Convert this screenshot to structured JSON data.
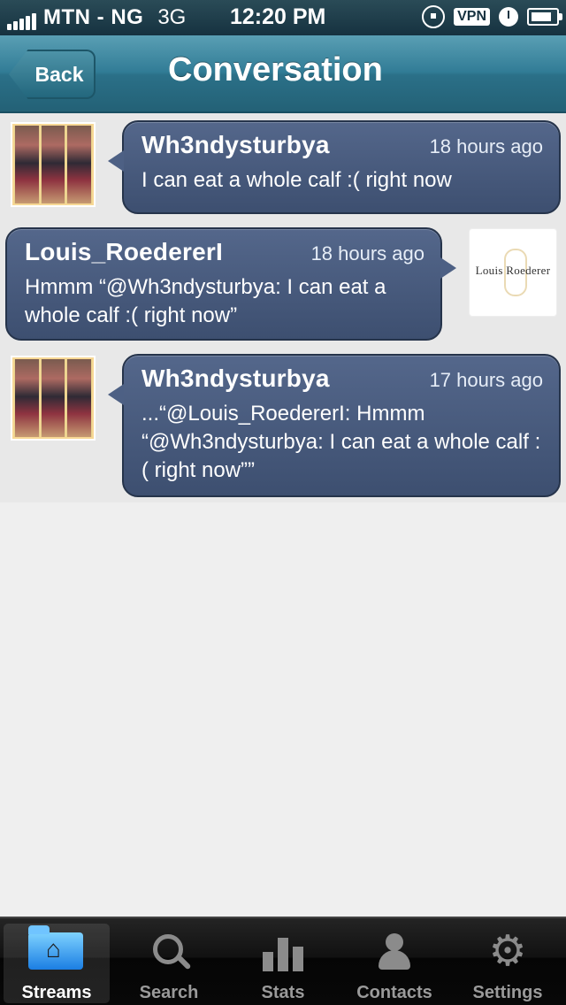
{
  "status_bar": {
    "carrier": "MTN - NG",
    "network": "3G",
    "time": "12:20 PM",
    "vpn": "VPN"
  },
  "header": {
    "back_label": "Back",
    "title": "Conversation"
  },
  "messages": [
    {
      "author": "Wh3ndysturbya",
      "time": "18 hours ago",
      "text": "I can eat a whole calf :( right now"
    },
    {
      "author": "Louis_RoedererI",
      "time": "18 hours ago",
      "text": "Hmmm “@Wh3ndysturbya: I can eat a whole calf :( right now”",
      "logo_text": "Louis Roederer"
    },
    {
      "author": "Wh3ndysturbya",
      "time": "17 hours ago",
      "text": "...“@Louis_RoedererI: Hmmm “@Wh3ndysturbya: I can eat a whole calf :( right now””"
    }
  ],
  "tab_bar": {
    "tabs": [
      {
        "label": "Streams",
        "icon": "home-folder-icon",
        "active": true
      },
      {
        "label": "Search",
        "icon": "search-icon",
        "active": false
      },
      {
        "label": "Stats",
        "icon": "bar-chart-icon",
        "active": false
      },
      {
        "label": "Contacts",
        "icon": "person-icon",
        "active": false
      },
      {
        "label": "Settings",
        "icon": "gear-icon",
        "active": false
      }
    ]
  }
}
